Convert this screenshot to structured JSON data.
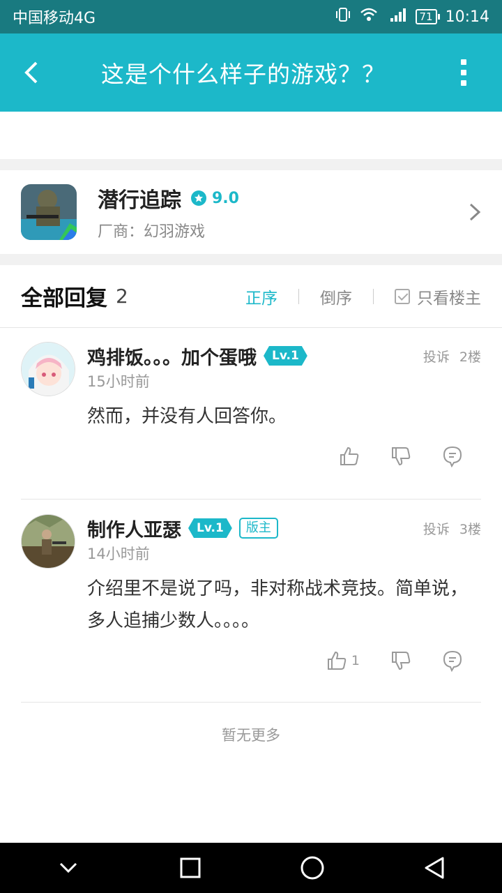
{
  "status": {
    "carrier": "中国移动4G",
    "network": "4G",
    "battery": "71",
    "time": "10:14"
  },
  "header": {
    "title": "这是个什么样子的游戏？？"
  },
  "game": {
    "name": "潜行追踪",
    "rating": "9.0",
    "vendor": "厂商：幻羽游戏"
  },
  "replies": {
    "title": "全部回复",
    "count": "2",
    "sort_asc": "正序",
    "sort_desc": "倒序",
    "only_op": "只看楼主",
    "items": [
      {
        "user": "鸡排饭。。。加个蛋哦",
        "level": "Lv.1",
        "badge": "",
        "report": "投诉",
        "floor": "2楼",
        "time": "15小时前",
        "content": "然而，并没有人回答你。",
        "likes": ""
      },
      {
        "user": "制作人亚瑟",
        "level": "Lv.1",
        "badge": "版主",
        "report": "投诉",
        "floor": "3楼",
        "time": "14小时前",
        "content": "介绍里不是说了吗，非对称战术竞技。简单说，多人追捕少数人。。。。",
        "likes": "1"
      }
    ],
    "no_more": "暂无更多"
  },
  "colors": {
    "accent": "#1cb8c9",
    "status_bar": "#197a80"
  }
}
